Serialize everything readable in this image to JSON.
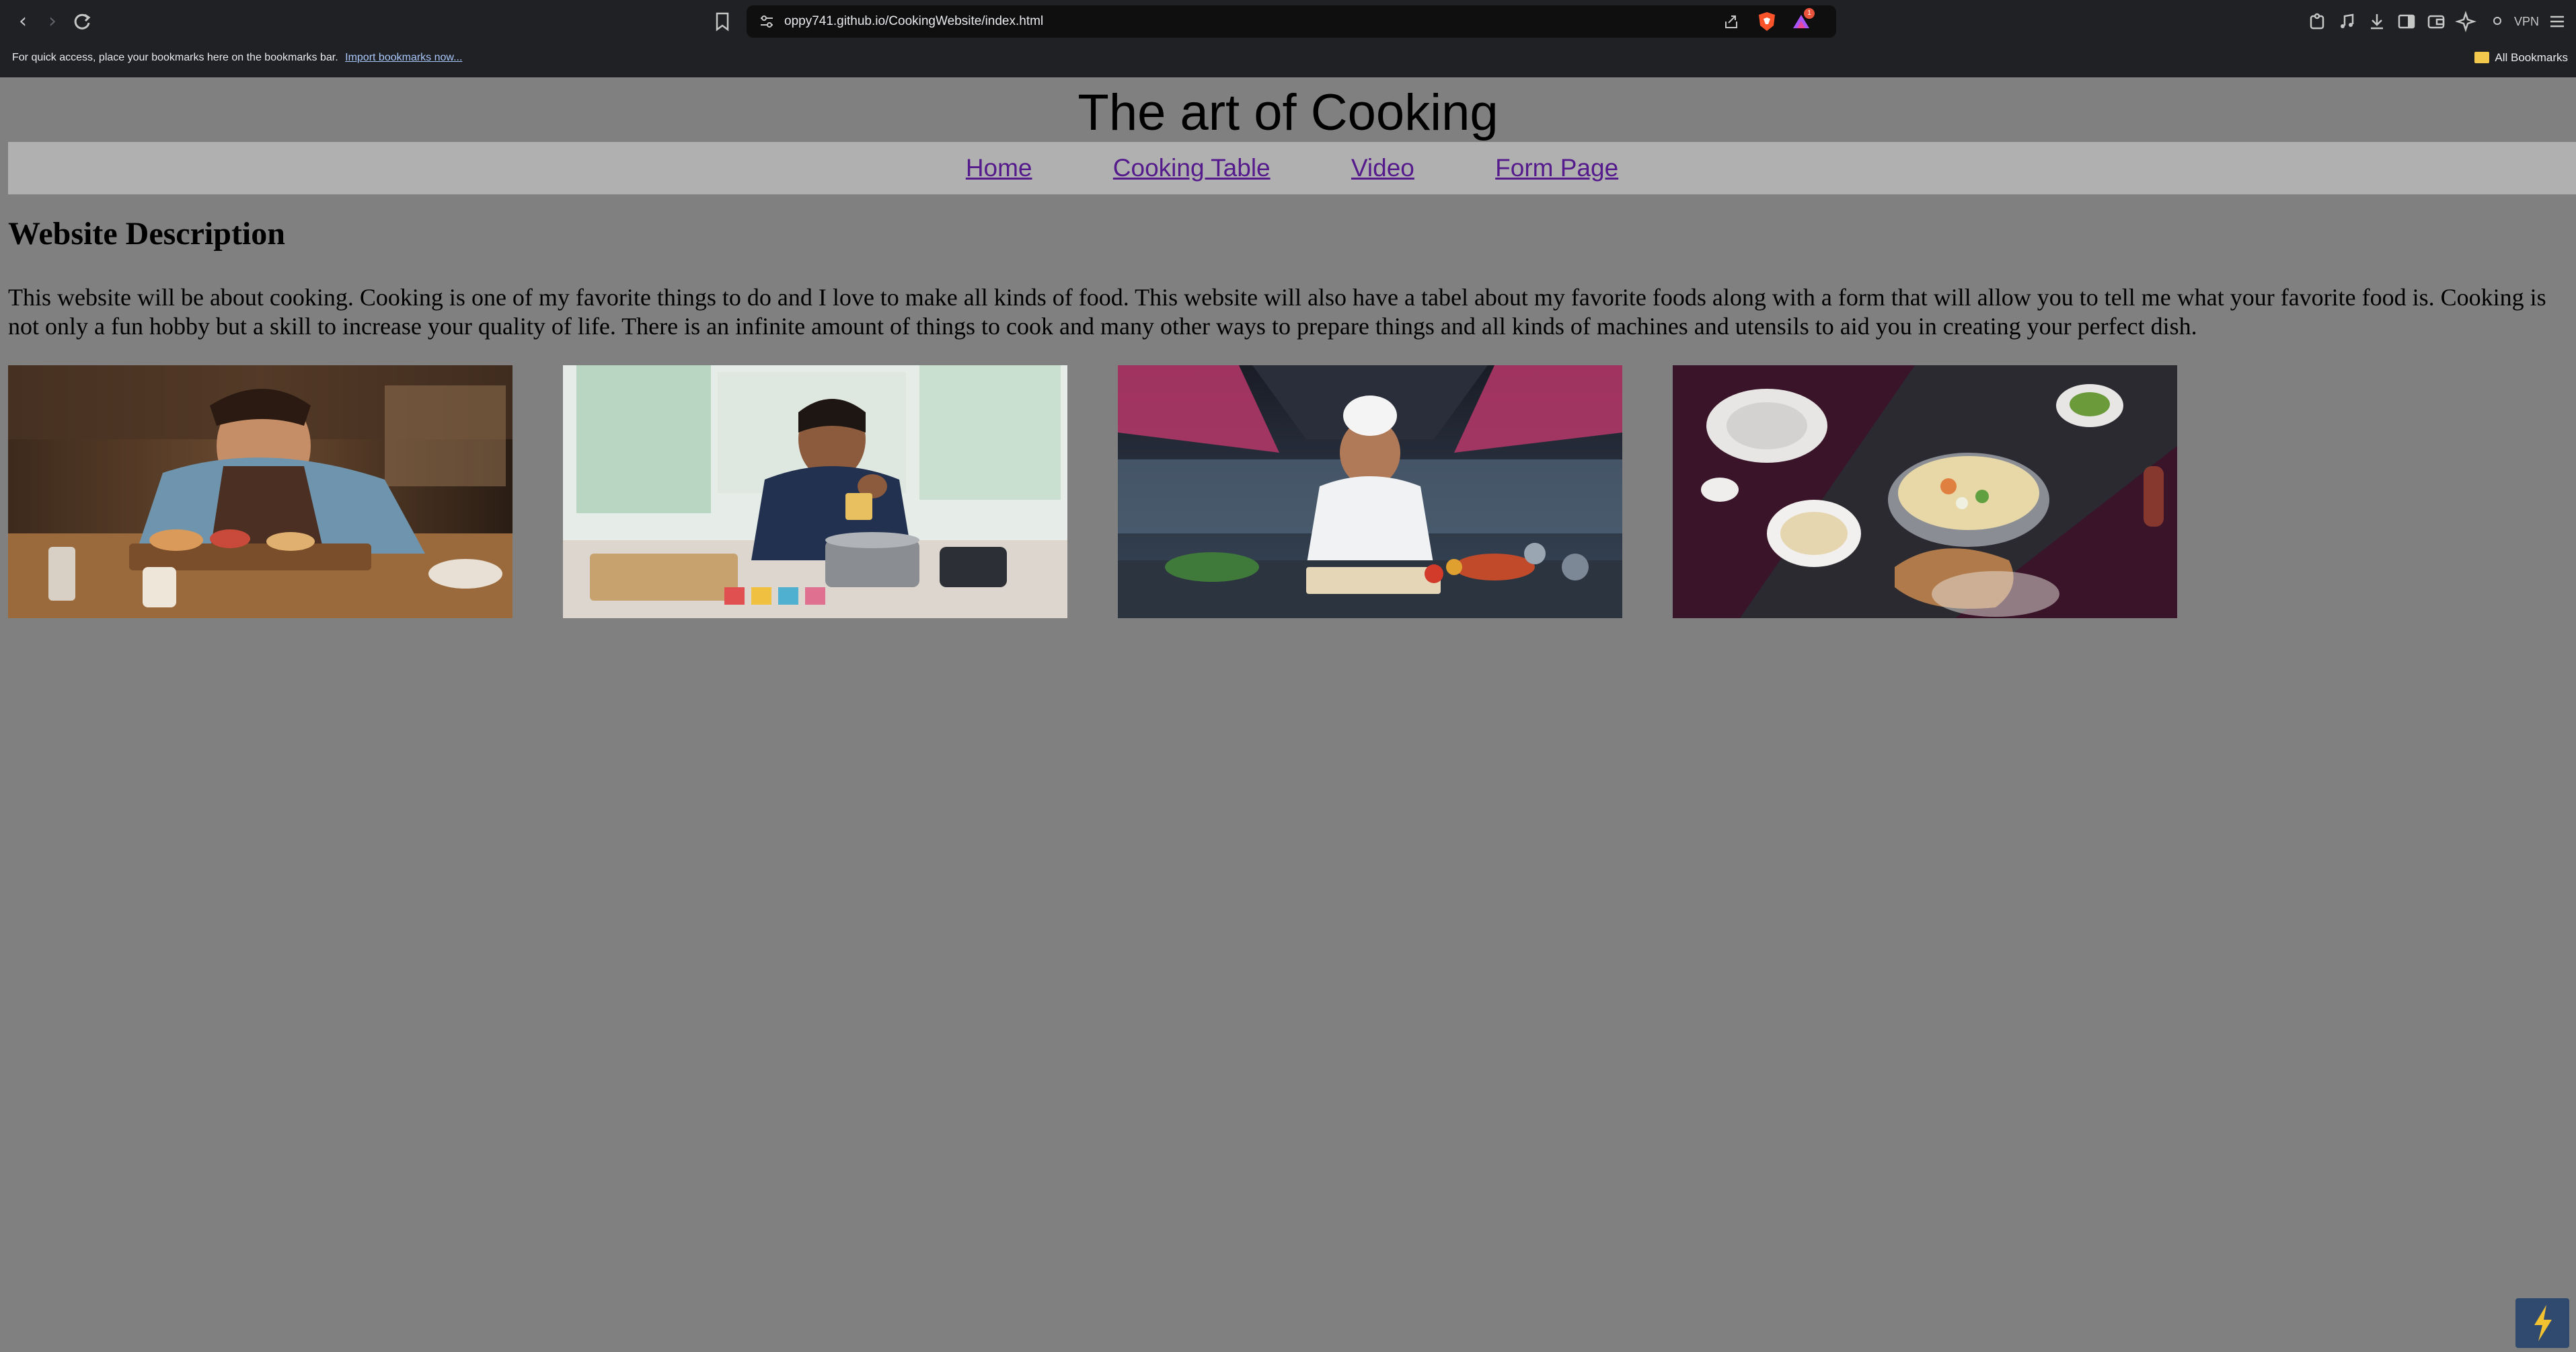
{
  "browser": {
    "url": "oppy741.github.io/CookingWebsite/index.html",
    "bookmarks_prompt": "For quick access, place your bookmarks here on the bookmarks bar.",
    "import_link": "Import bookmarks now...",
    "all_bookmarks": "All Bookmarks",
    "vpn_label": "VPN",
    "rewards_badge": "1"
  },
  "page": {
    "title": "The art of Cooking",
    "nav": [
      "Home",
      "Cooking Table",
      "Video",
      "Form Page"
    ],
    "section_heading": "Website Description",
    "description": "This website will be about cooking. Cooking is one of my favorite things to do and I love to make all kinds of food. This website will also have a tabel about my favorite foods along with a form that will allow you to tell me what your favorite food is. Cooking is not only a fun hobby but a skill to increase your quality of life. There is an infinite amount of things to cook and many other ways to prepare things and all kinds of machines and utensils to aid you in creating your perfect dish."
  },
  "colors": {
    "page_background": "#808080",
    "nav_background": "#b0b0b0",
    "link": "#551a8b",
    "chrome": "#202124"
  },
  "icons": [
    "back-icon",
    "forward-icon",
    "reload-icon",
    "bookmark-icon",
    "site-settings-icon",
    "share-icon",
    "brave-shield-icon",
    "brave-rewards-icon",
    "extensions-icon",
    "media-icon",
    "downloads-icon",
    "sidebar-icon",
    "wallet-icon",
    "leo-ai-icon",
    "menu-icon",
    "folder-icon"
  ]
}
